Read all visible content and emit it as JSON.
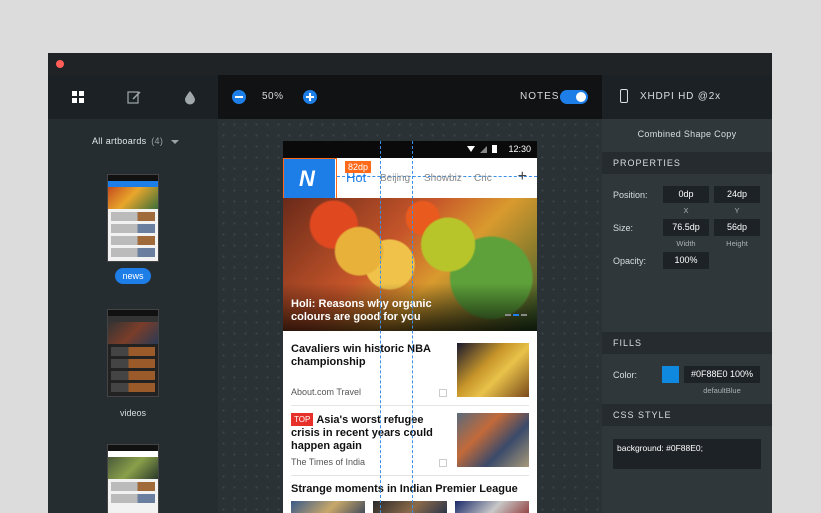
{
  "toolbar": {
    "zoom": "50%",
    "notes_label": "NOTES",
    "notes_on": true,
    "device_label": "XHDPI HD @2x"
  },
  "left_panel": {
    "title": "All artboards",
    "count": "(4)",
    "artboards": [
      {
        "label": "news",
        "selected": true
      },
      {
        "label": "videos",
        "selected": false
      },
      {
        "label": "",
        "selected": false
      }
    ]
  },
  "phone": {
    "time": "12:30",
    "dp_badge": "82dp",
    "logo_letter": "N",
    "tabs": [
      "Hot",
      "Beijing",
      "Showbiz",
      "Cric"
    ],
    "add_tab": "+",
    "hero_title": "Holi: Reasons why organic colours are good for you",
    "stories": [
      {
        "title": "Cavaliers win historic NBA championship",
        "source": "About.com Travel"
      },
      {
        "badge": "TOP",
        "title": "Asia's worst refugee crisis in recent years could happen again",
        "source": "The Times of India"
      },
      {
        "title": "Strange moments in Indian Premier League"
      }
    ]
  },
  "inspector": {
    "element_name": "Combined Shape Copy",
    "properties_header": "PROPERTIES",
    "position_label": "Position:",
    "x_value": "0dp",
    "x_label": "X",
    "y_value": "24dp",
    "y_label": "Y",
    "size_label": "Size:",
    "width_value": "76.5dp",
    "width_label": "Width",
    "height_value": "56dp",
    "height_label": "Height",
    "opacity_label": "Opacity:",
    "opacity_value": "100%",
    "fills_header": "FILLS",
    "color_label": "Color:",
    "color_value": "#0F88E0 100%",
    "color_name": "defaultBlue",
    "swatch_color": "#0f88e0",
    "css_header": "CSS STYLE",
    "css_value": "background: #0F88E0;"
  }
}
